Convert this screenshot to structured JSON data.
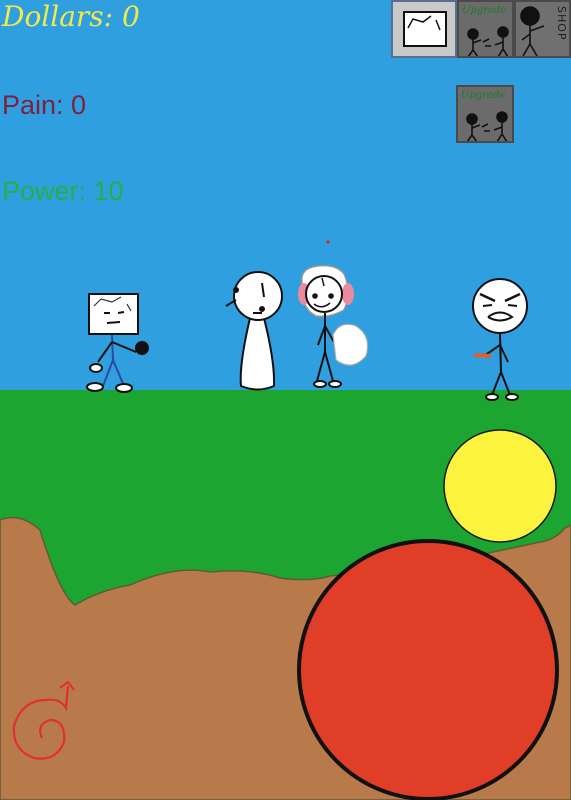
{
  "hud": {
    "dollars": "Dollars: 0",
    "pain": "Pain: 0",
    "power": "Power: 10"
  },
  "buttons": {
    "upgrade_top_label": "Upgrade",
    "upgrade_2_label": "Upgrade",
    "shop_label": "SHOP"
  },
  "colors": {
    "sky": "#2f9fe0",
    "grass": "#1da532",
    "dirt": "#b87a4b",
    "yellow_button": "#fbf33d",
    "red_button": "#e03e27",
    "dollars_text": "#f2e94a",
    "pain_text": "#7c2240",
    "power_text": "#1fb24a"
  },
  "icons": [
    "arrow-spiral-icon",
    "fighter-preview-icon",
    "skin-preview-icon"
  ]
}
